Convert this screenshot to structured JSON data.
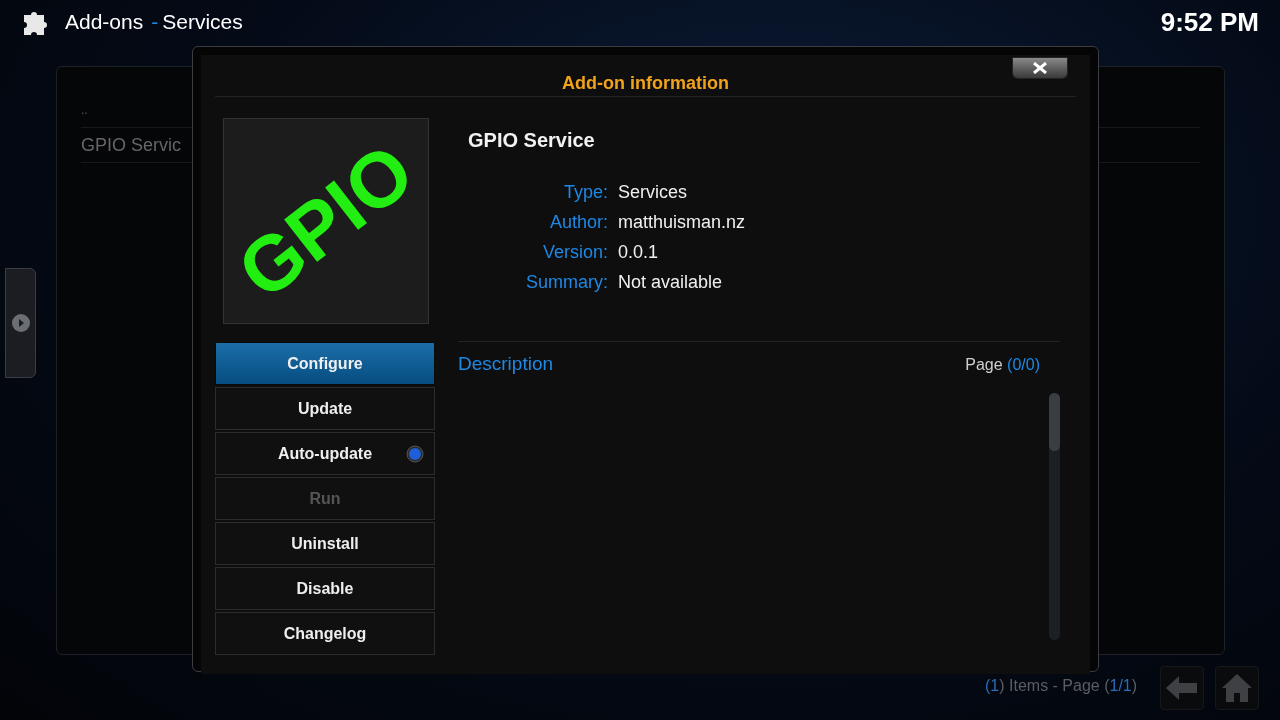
{
  "header": {
    "section": "Add-ons",
    "separator": "-",
    "subsection": "Services",
    "clock": "9:52 PM"
  },
  "list": {
    "items": [
      {
        "label": ".."
      },
      {
        "label": "GPIO Servic"
      }
    ]
  },
  "footer": {
    "count": [
      {
        "text": "(",
        "highlight": true
      },
      {
        "text": "1",
        "highlight": true
      },
      {
        "text": ") Items - Page (",
        "highlight": false
      },
      {
        "text": "1/1",
        "highlight": true
      },
      {
        "text": ")",
        "highlight": false
      }
    ]
  },
  "dialog": {
    "title": "Add-on information",
    "logo_text": "GPIO",
    "name": "GPIO Service",
    "fields": [
      {
        "label": "Type:",
        "value": "Services"
      },
      {
        "label": "Author:",
        "value": "matthuisman.nz"
      },
      {
        "label": "Version:",
        "value": "0.0.1"
      },
      {
        "label": "Summary:",
        "value": "Not available"
      }
    ],
    "buttons": [
      {
        "label": "Configure",
        "selected": true,
        "disabled": false
      },
      {
        "label": "Update",
        "selected": false,
        "disabled": false
      },
      {
        "label": "Auto-update",
        "selected": false,
        "disabled": false,
        "kind": "toggle",
        "on": true
      },
      {
        "label": "Run",
        "selected": false,
        "disabled": true
      },
      {
        "label": "Uninstall",
        "selected": false,
        "disabled": false
      },
      {
        "label": "Disable",
        "selected": false,
        "disabled": false
      },
      {
        "label": "Changelog",
        "selected": false,
        "disabled": false
      }
    ],
    "description": {
      "heading": "Description",
      "page": [
        {
          "text": "Page ",
          "highlight": false
        },
        {
          "text": "(0/0)",
          "highlight": true
        }
      ]
    }
  }
}
